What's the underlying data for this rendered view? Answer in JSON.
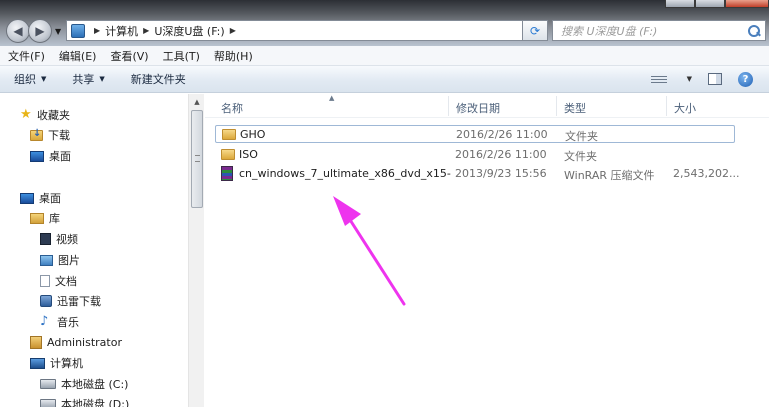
{
  "window": {
    "address_path": [
      "计算机",
      "U深度U盘 (F:)"
    ],
    "search_placeholder": "搜索 U深度U盘 (F:)"
  },
  "menubar": {
    "items": [
      "文件(F)",
      "编辑(E)",
      "查看(V)",
      "工具(T)",
      "帮助(H)"
    ]
  },
  "commandbar": {
    "organize": "组织",
    "share": "共享",
    "new_folder": "新建文件夹"
  },
  "navpane": {
    "favorites": "收藏夹",
    "downloads": "下载",
    "desktop_fav": "桌面",
    "desktop": "桌面",
    "libraries": "库",
    "videos": "视频",
    "pictures": "图片",
    "documents": "文档",
    "thunder": "迅雷下载",
    "music": "音乐",
    "user": "Administrator",
    "computer": "计算机",
    "disk_c": "本地磁盘 (C:)",
    "disk_d": "本地磁盘 (D:)"
  },
  "filelist": {
    "columns": {
      "name": "名称",
      "date": "修改日期",
      "type": "类型",
      "size": "大小"
    },
    "rows": [
      {
        "name": "GHO",
        "date": "2016/2/26 11:00",
        "type": "文件夹",
        "size": ""
      },
      {
        "name": "ISO",
        "date": "2016/2/26 11:00",
        "type": "文件夹",
        "size": ""
      },
      {
        "name": "cn_windows_7_ultimate_x86_dvd_x15-...",
        "date": "2013/9/23 15:56",
        "type": "WinRAR 压缩文件",
        "size": "2,543,202..."
      }
    ]
  },
  "colors": {
    "annotation_arrow": "#ee34ee",
    "selection_border": "#9fb8d6",
    "header_text": "#4c607a"
  }
}
